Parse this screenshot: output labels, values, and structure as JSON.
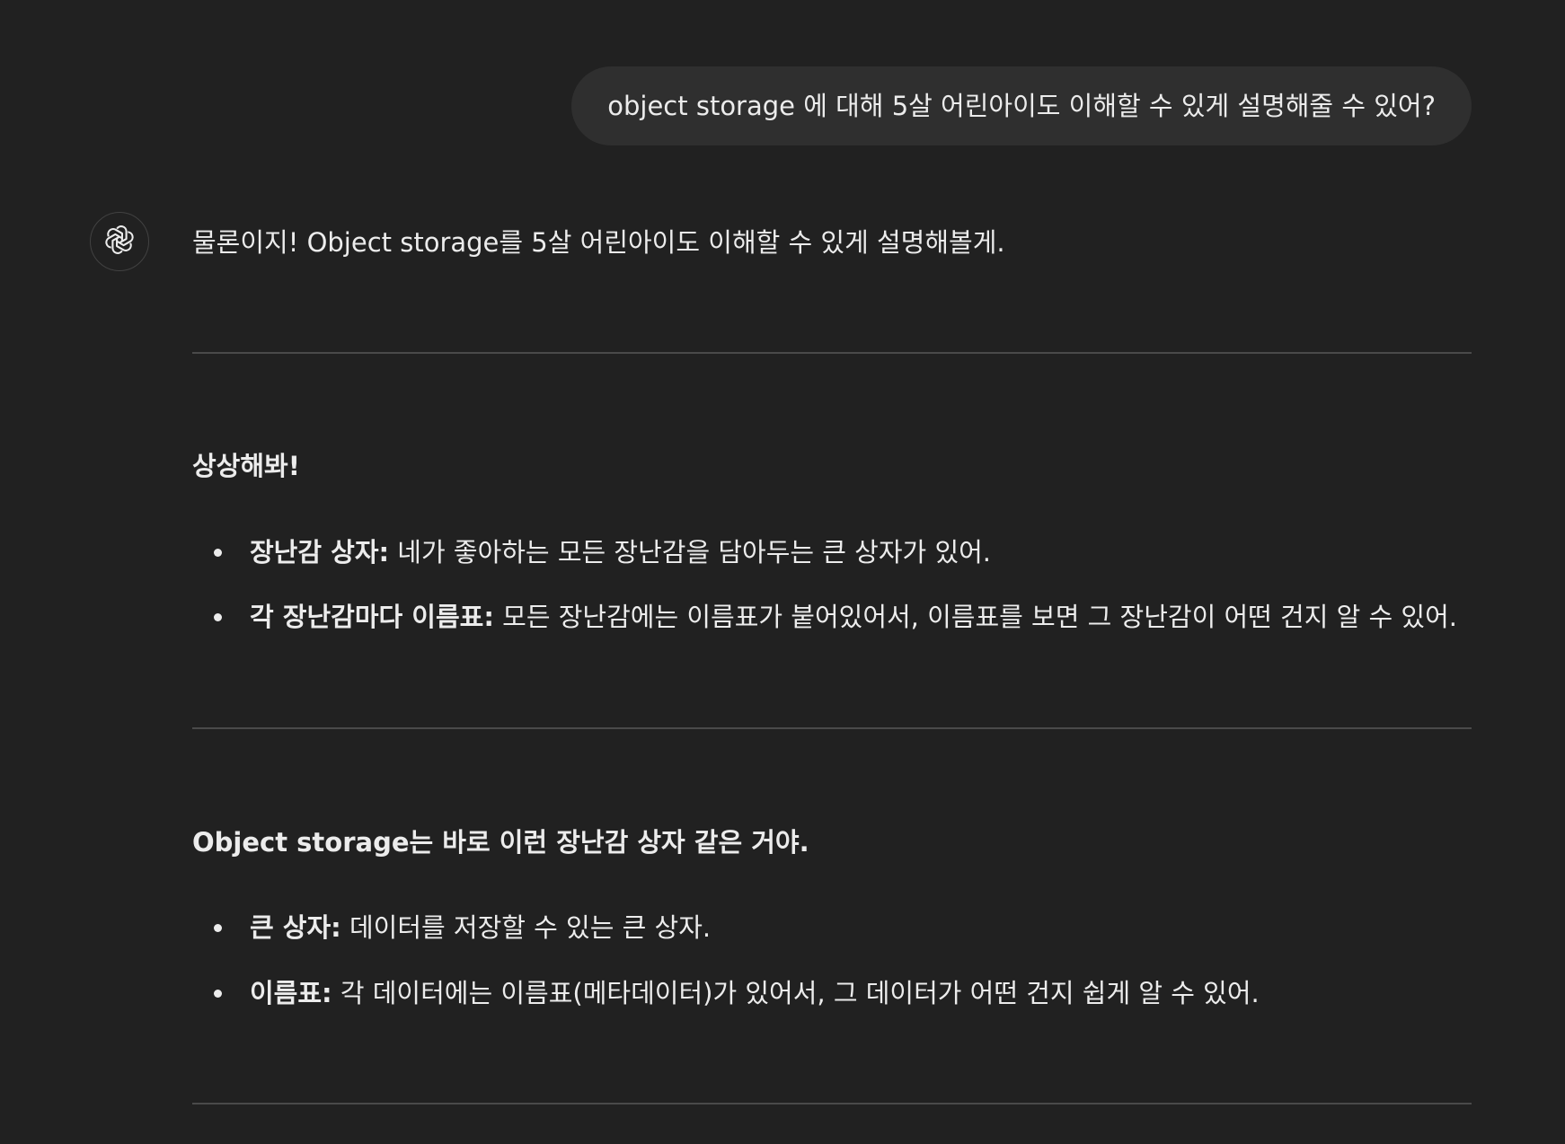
{
  "conversation": {
    "user_message": "object storage 에 대해 5살 어린아이도 이해할 수 있게 설명해줄 수 있어?",
    "assistant": {
      "avatar_icon": "openai-logo-icon",
      "intro": "물론이지! Object storage를 5살 어린아이도 이해할 수 있게 설명해볼게.",
      "sections": [
        {
          "heading": "상상해봐!",
          "items": [
            {
              "term": "장난감 상자:",
              "text": " 네가 좋아하는 모든 장난감을 담아두는 큰 상자가 있어."
            },
            {
              "term": "각 장난감마다 이름표:",
              "text": " 모든 장난감에는 이름표가 붙어있어서, 이름표를 보면 그 장난감이 어떤 건지 알 수 있어."
            }
          ]
        },
        {
          "heading": "Object storage는 바로 이런 장난감 상자 같은 거야.",
          "items": [
            {
              "term": "큰 상자:",
              "text": " 데이터를 저장할 수 있는 큰 상자."
            },
            {
              "term": "이름표:",
              "text": " 각 데이터에는 이름표(메타데이터)가 있어서, 그 데이터가 어떤 건지 쉽게 알 수 있어."
            }
          ]
        }
      ]
    }
  },
  "colors": {
    "background": "#212121",
    "user_bubble": "#2f2f2f",
    "text": "#ececec",
    "divider": "#4a4a4a"
  }
}
